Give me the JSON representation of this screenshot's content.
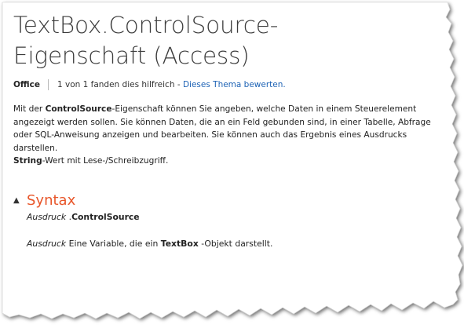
{
  "page": {
    "title_line1": "TextBox.ControlSource-",
    "title_line2": "Eigenschaft (Access)"
  },
  "meta": {
    "brand": "Office",
    "helpful": "1 von 1 fanden dies hilfreich - ",
    "rate_link": "Dieses Thema bewerten."
  },
  "intro": {
    "p1_before": "Mit der ",
    "p1_bold": "ControlSource",
    "p1_after": "-Eigenschaft können Sie angeben, welche Daten in einem Steuerelement angezeigt werden sollen. Sie können Daten, die an ein Feld gebunden sind, in einer Tabelle, Abfrage oder SQL-Anweisung anzeigen und bearbeiten. Sie können auch das Ergebnis eines Ausdrucks darstellen.",
    "p2_bold": "String",
    "p2_after": "-Wert mit Lese-/Schreibzugriff."
  },
  "syntax": {
    "toggle_icon": "▲",
    "heading": "Syntax",
    "expr_italic": "Ausdruck",
    "expr_dot": " .",
    "expr_bold": "ControlSource",
    "param_italic": "Ausdruck",
    "param_mid": " Eine Variable, die ein ",
    "param_bold": "TextBox",
    "param_after": " -Objekt darstellt."
  },
  "colors": {
    "link": "#1e63b5",
    "heading_accent": "#e8562a",
    "text": "#222222"
  }
}
